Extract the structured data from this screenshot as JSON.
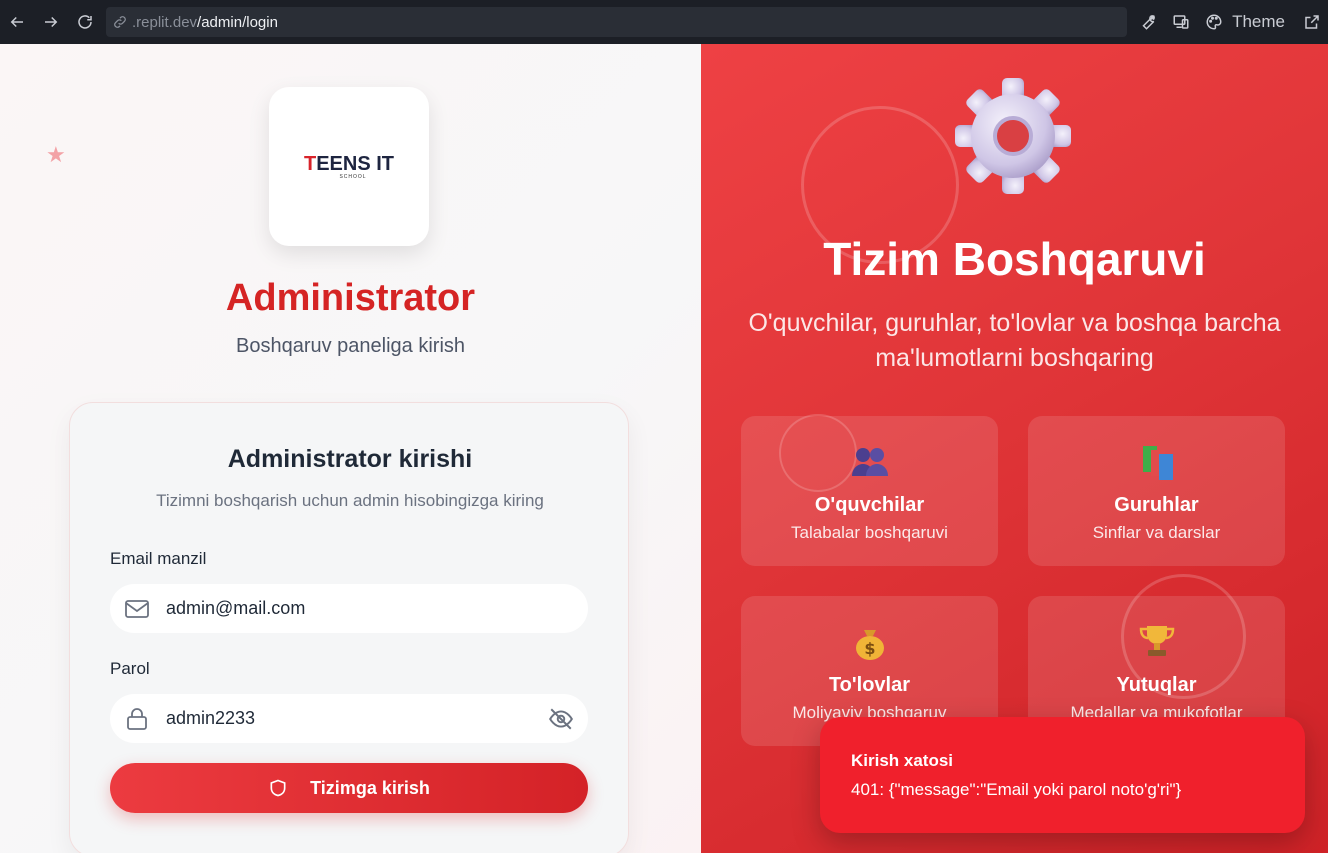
{
  "browser": {
    "url_prefix": ".replit.dev",
    "url_path": "/admin/login",
    "theme_label": "Theme"
  },
  "left": {
    "logo_text_t": "T",
    "logo_text_rest": "EENS IT",
    "logo_sub": "SCHOOL",
    "title": "Administrator",
    "subtitle": "Boshqaruv paneliga kirish",
    "form": {
      "title": "Administrator kirishi",
      "subtitle": "Tizimni boshqarish uchun admin hisobingizga kiring",
      "email_label": "Email manzil",
      "email_value": "admin@mail.com",
      "password_label": "Parol",
      "password_value": "admin2233",
      "submit_label": "Tizimga kirish"
    }
  },
  "right": {
    "title": "Tizim Boshqaruvi",
    "subtitle": "O'quvchilar, guruhlar, to'lovlar va boshqa barcha ma'lumotlarni boshqaring",
    "features": [
      {
        "title": "O'quvchilar",
        "subtitle": "Talabalar boshqaruvi",
        "icon": "students-icon"
      },
      {
        "title": "Guruhlar",
        "subtitle": "Sinflar va darslar",
        "icon": "books-icon"
      },
      {
        "title": "To'lovlar",
        "subtitle": "Moliyaviy boshqaruv",
        "icon": "money-bag-icon"
      },
      {
        "title": "Yutuqlar",
        "subtitle": "Medallar va mukofotlar",
        "icon": "trophy-icon"
      }
    ]
  },
  "toast": {
    "title": "Kirish xatosi",
    "message": "401: {\"message\":\"Email yoki parol noto'g'ri\"}"
  },
  "colors": {
    "brand_red": "#d52424",
    "panel_red": "#e03538",
    "toast_red": "#f0202c",
    "browser_bg": "#1c1f26"
  }
}
